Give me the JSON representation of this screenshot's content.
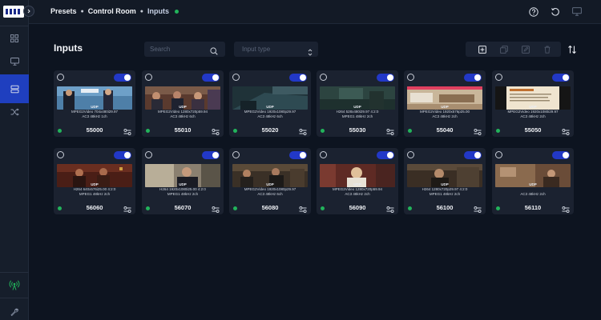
{
  "breadcrumb": {
    "items": [
      "Presets",
      "Control Room"
    ],
    "current": "Inputs"
  },
  "page": {
    "title": "Inputs"
  },
  "search": {
    "placeholder": "Search"
  },
  "filter": {
    "placeholder": "Input type"
  },
  "icons": {
    "sidebar": [
      "grid-icon",
      "monitor-icon",
      "layers-icon",
      "shuffle-icon",
      "broadcast-icon",
      "wrench-icon"
    ],
    "top": [
      "help-icon",
      "refresh-icon",
      "display-icon"
    ],
    "toolbar": [
      "add-icon",
      "duplicate-icon",
      "edit-icon",
      "delete-icon"
    ],
    "sort": "sort-icon"
  },
  "colors": {
    "accent": "#1f3fbf",
    "toggle_on": "#2238c7",
    "status_ok": "#22b35b",
    "background": "#0d1420",
    "card": "#1b2230",
    "broadcast": "#22b35b"
  },
  "inputs": [
    {
      "protocol": "UDP",
      "line1": "MPEG2Video 704x480i29.97",
      "line2": "AC3 48kHz 1ch",
      "port": "55000",
      "enabled": true,
      "status": "ok"
    },
    {
      "protocol": "UDP",
      "line1": "MPEG2Video 1280x720p59.94",
      "line2": "AC3 48kHz 6ch",
      "port": "55010",
      "enabled": true,
      "status": "ok"
    },
    {
      "protocol": "UDP",
      "line1": "MPEG2Video 1920x1080p29.97",
      "line2": "AC3 48kHz 6ch",
      "port": "55020",
      "enabled": true,
      "status": "ok"
    },
    {
      "protocol": "UDP",
      "line1": "H264 528x480i29.97 4:2:0",
      "line2": "MPEG1 48kHz 2ch",
      "port": "55030",
      "enabled": true,
      "status": "ok"
    },
    {
      "protocol": "UDP",
      "line1": "MPEG2Video 1920x576p25.00",
      "line2": "AC3 48kHz 2ch",
      "port": "55040",
      "enabled": true,
      "status": "ok"
    },
    {
      "protocol": "UDP",
      "line1": "MPEG2Video 1920x1080i29.97",
      "line2": "AC3 48kHz 2ch",
      "port": "55050",
      "enabled": true,
      "status": "ok"
    },
    {
      "protocol": "UDP",
      "line1": "H264 640x576i25.00 4:2:0",
      "line2": "MPEG1 48kHz 2ch",
      "port": "56060",
      "enabled": true,
      "status": "ok"
    },
    {
      "protocol": "UDP",
      "line1": "H264 1920x1080i25.00 4:2:0",
      "line2": "MPEG1 48kHz 2ch",
      "port": "56070",
      "enabled": true,
      "status": "ok"
    },
    {
      "protocol": "UDP",
      "line1": "MPEG2Video 1920x1080p29.97",
      "line2": "AC3 48kHz 6ch",
      "port": "56080",
      "enabled": true,
      "status": "ok"
    },
    {
      "protocol": "UDP",
      "line1": "MPEG2Video 1280x720p59.94",
      "line2": "AC3 48kHz 2ch",
      "port": "56090",
      "enabled": true,
      "status": "ok"
    },
    {
      "protocol": "UDP",
      "line1": "H264 1280x720p29.97 4:2:0",
      "line2": "MPEG1 48kHz 2ch",
      "port": "56100",
      "enabled": true,
      "status": "ok"
    },
    {
      "protocol": "UDP",
      "line1": "",
      "line2": "AC3 48kHz 2ch",
      "port": "56110",
      "enabled": true,
      "status": "ok"
    }
  ]
}
